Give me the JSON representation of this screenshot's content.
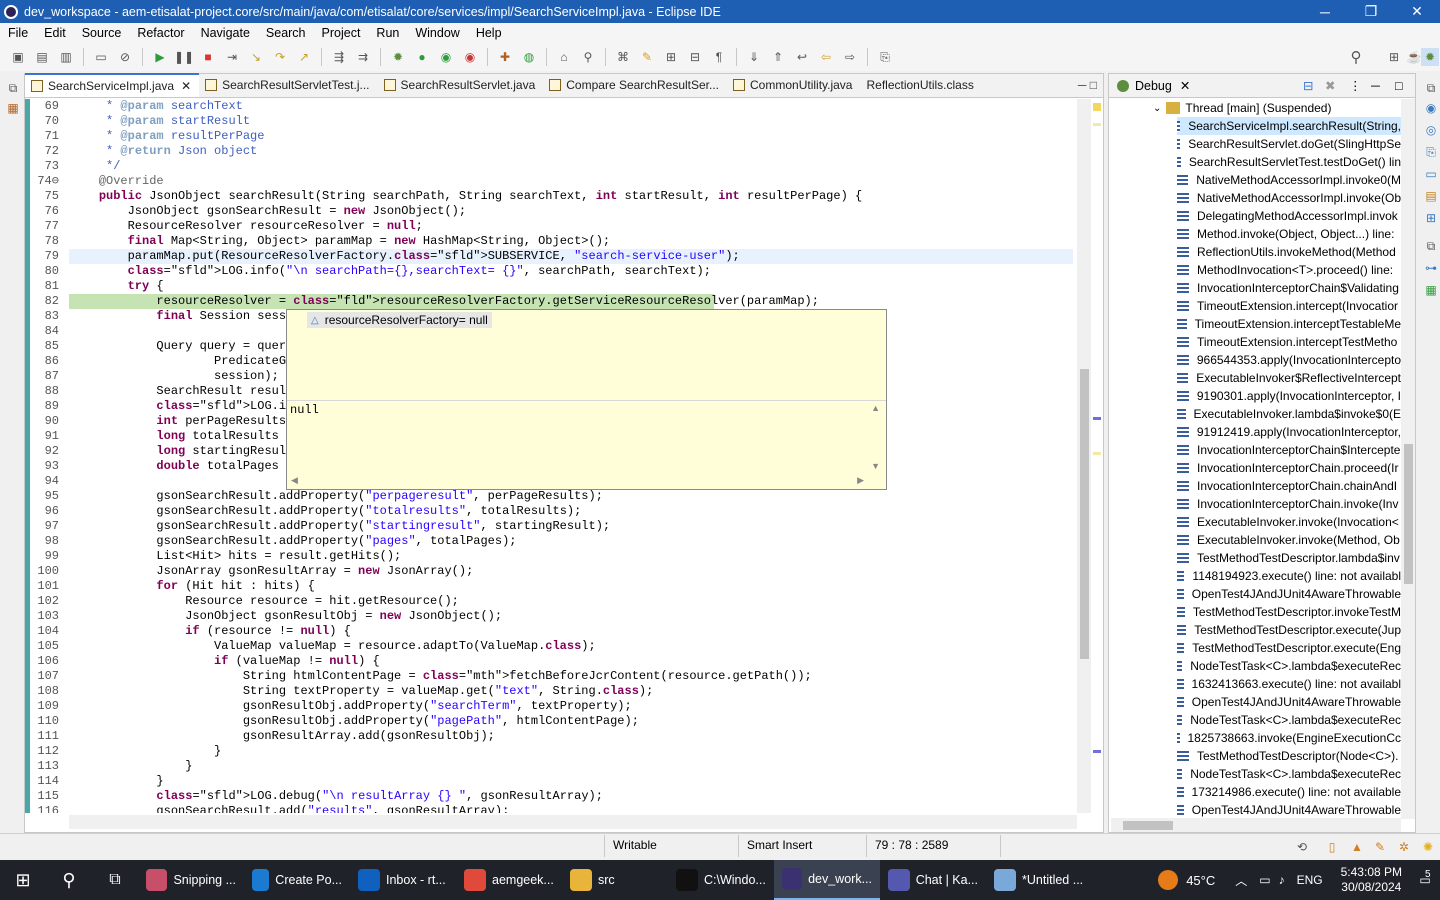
{
  "window": {
    "title": "dev_workspace - aem-etisalat-project.core/src/main/java/com/etisalat/core/services/impl/SearchServiceImpl.java - Eclipse IDE",
    "minimize": "─",
    "maximize": "❐",
    "close": "✕"
  },
  "menu": [
    "File",
    "Edit",
    "Source",
    "Refactor",
    "Navigate",
    "Search",
    "Project",
    "Run",
    "Window",
    "Help"
  ],
  "editor_tabs": [
    {
      "label": "SearchServiceImpl.java",
      "close": "✕"
    },
    {
      "label": "SearchResultServletTest.j..."
    },
    {
      "label": "SearchResultServlet.java"
    },
    {
      "label": "Compare SearchResultSer..."
    },
    {
      "label": "CommonUtility.java"
    },
    {
      "label": "ReflectionUtils.class"
    }
  ],
  "line_numbers": [
    "69",
    "70",
    "71",
    "72",
    "73",
    "74⊖",
    "75",
    "76",
    "77",
    "78",
    "79",
    "80",
    "81",
    "82",
    "83",
    "84",
    "85",
    "86",
    "87",
    "88",
    "89",
    "90",
    "91",
    "92",
    "93",
    "94",
    "95",
    "96",
    "97",
    "98",
    "99",
    "100",
    "101",
    "102",
    "103",
    "104",
    "105",
    "106",
    "107",
    "108",
    "109",
    "110",
    "111",
    "112",
    "113",
    "114",
    "115",
    "116"
  ],
  "code_lines": [
    "     * @param searchText",
    "     * @param startResult",
    "     * @param resultPerPage",
    "     * @return Json object",
    "     */",
    "    @Override",
    "    public JsonObject searchResult(String searchPath, String searchText, int startResult, int resultPerPage) {",
    "        JsonObject gsonSearchResult = new JsonObject();",
    "        ResourceResolver resourceResolver = null;",
    "        final Map<String, Object> paramMap = new HashMap<String, Object>();",
    "        paramMap.put(ResourceResolverFactory.SUBSERVICE, \"search-service-user\");",
    "        LOG.info(\"\\n searchPath={},searchText= {}\", searchPath, searchText);",
    "        try {",
    "            resourceResolver = resourceResolverFactory.getServiceResourceResolver(paramMap);",
    "            final Session sessi",
    "",
    "            Query query = query",
    "                    PredicateGr                                                                             ),",
    "                    session);",
    "            SearchResult result",
    "            LOG.info(\"\\n QUERY",
    "            int perPageResults",
    "            long totalResults =",
    "            long startingResult",
    "            double totalPages =",
    "",
    "            gsonSearchResult.addProperty(\"perpageresult\", perPageResults);",
    "            gsonSearchResult.addProperty(\"totalresults\", totalResults);",
    "            gsonSearchResult.addProperty(\"startingresult\", startingResult);",
    "            gsonSearchResult.addProperty(\"pages\", totalPages);",
    "            List<Hit> hits = result.getHits();",
    "            JsonArray gsonResultArray = new JsonArray();",
    "            for (Hit hit : hits) {",
    "                Resource resource = hit.getResource();",
    "                JsonObject gsonResultObj = new JsonObject();",
    "                if (resource != null) {",
    "                    ValueMap valueMap = resource.adaptTo(ValueMap.class);",
    "                    if (valueMap != null) {",
    "                        String htmlContentPage = fetchBeforeJcrContent(resource.getPath());",
    "                        String textProperty = valueMap.get(\"text\", String.class);",
    "                        gsonResultObj.addProperty(\"searchTerm\", textProperty);",
    "                        gsonResultObj.addProperty(\"pagePath\", htmlContentPage);",
    "                        gsonResultArray.add(gsonResultObj);",
    "                    }",
    "                }",
    "            }",
    "            LOG.debug(\"\\n resultArray {} \", gsonResultArray);",
    "            gsonSearchResult.add(\"results\", gsonResultArray);"
  ],
  "hover_popup": {
    "expression": "resourceResolverFactory= null",
    "value": "null"
  },
  "debug": {
    "tab_label": "Debug",
    "thread": "Thread [main] (Suspended)",
    "frames": [
      "SearchServiceImpl.searchResult(String,",
      "SearchResultServlet.doGet(SlingHttpSe",
      "SearchResultServletTest.testDoGet() lin",
      "NativeMethodAccessorImpl.invoke0(M",
      "NativeMethodAccessorImpl.invoke(Ob",
      "DelegatingMethodAccessorImpl.invok",
      "Method.invoke(Object, Object...) line:",
      "ReflectionUtils.invokeMethod(Method",
      "MethodInvocation<T>.proceed() line:",
      "InvocationInterceptorChain$Validating",
      "TimeoutExtension.intercept(Invocatior",
      "TimeoutExtension.interceptTestableMe",
      "TimeoutExtension.interceptTestMetho",
      "966544353.apply(InvocationIntercepto",
      "ExecutableInvoker$ReflectiveIntercept",
      "9190301.apply(InvocationInterceptor, I",
      "ExecutableInvoker.lambda$invoke$0(E",
      "91912419.apply(InvocationInterceptor,",
      "InvocationInterceptorChain$Intercepte",
      "InvocationInterceptorChain.proceed(Ir",
      "InvocationInterceptorChain.chainAndI",
      "InvocationInterceptorChain.invoke(Inv",
      "ExecutableInvoker.invoke(Invocation<",
      "ExecutableInvoker.invoke(Method, Ob",
      "TestMethodTestDescriptor.lambda$inv",
      "1148194923.execute() line: not availabl",
      "OpenTest4JAndJUnit4AwareThrowable",
      "TestMethodTestDescriptor.invokeTestM",
      "TestMethodTestDescriptor.execute(Jup",
      "TestMethodTestDescriptor.execute(Eng",
      "NodeTestTask<C>.lambda$executeRec",
      "1632413663.execute() line: not availabl",
      "OpenTest4JAndJUnit4AwareThrowable",
      "NodeTestTask<C>.lambda$executeRec",
      "1825738663.invoke(EngineExecutionCc",
      "TestMethodTestDescriptor(Node<C>).",
      "NodeTestTask<C>.lambda$executeRec",
      "173214986.execute() line: not available",
      "OpenTest4JAndJUnit4AwareThrowable"
    ]
  },
  "statusbar": {
    "mode": "Writable",
    "insert": "Smart Insert",
    "position": "79 : 78 : 2589"
  },
  "taskbar": {
    "items": [
      {
        "label": "Snipping ...",
        "color": "#c74f6a"
      },
      {
        "label": "Create Po...",
        "color": "#1b7bd0"
      },
      {
        "label": "Inbox - rt...",
        "color": "#1060c0"
      },
      {
        "label": "aemgeek...",
        "color": "#e04a3a"
      },
      {
        "label": "src",
        "color": "#e9b43a"
      },
      {
        "label": "C:\\Windo...",
        "color": "#111111"
      },
      {
        "label": "dev_work...",
        "color": "#3b3070"
      },
      {
        "label": "Chat | Ka...",
        "color": "#5558af"
      },
      {
        "label": "*Untitled ...",
        "color": "#7aa8d8"
      }
    ],
    "weather": "45°C",
    "lang": "ENG",
    "time": "5:43:08 PM",
    "date": "30/08/2024",
    "notifications": "5"
  },
  "colors": {
    "titlebar": "#1e5fb4",
    "debug_line": "#c6e3b4",
    "current_line": "#e8f2fe",
    "popup_bg": "#fffed8",
    "keyword": "#7f0055",
    "string": "#2a00ff"
  }
}
